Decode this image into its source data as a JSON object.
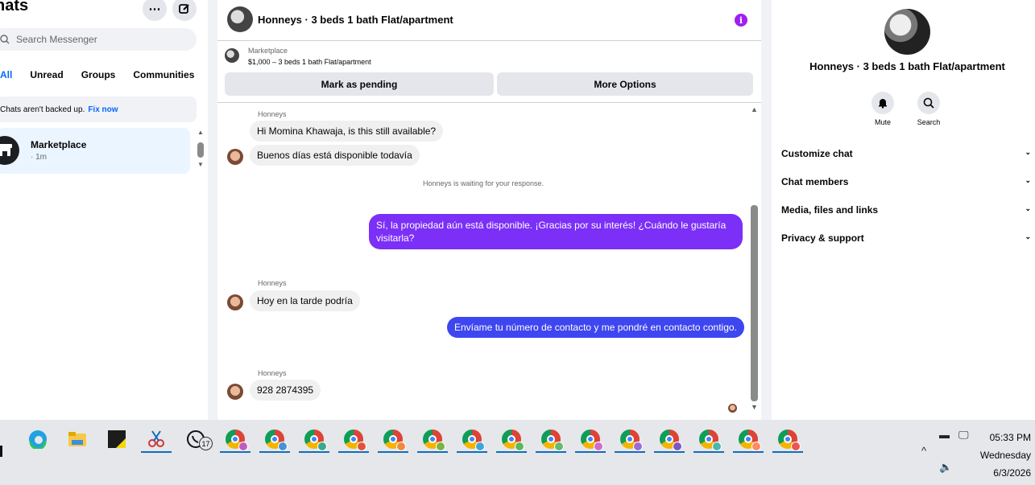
{
  "sidebar": {
    "title": "hats",
    "more_icon": "more-dots-icon",
    "compose_icon": "compose-icon",
    "search_placeholder": "Search Messenger",
    "filters": [
      "All",
      "Unread",
      "Groups",
      "Communities"
    ],
    "backup_note": "Chats aren't backed up.",
    "fix_link": "Fix now",
    "chats": [
      {
        "name": "Marketplace",
        "time": "· 1m"
      }
    ]
  },
  "conversation": {
    "title": "Honneys · 3 beds 1 bath Flat/apartment",
    "marketplace_label": "Marketplace",
    "listing": "$1,000 – 3 beds 1 bath Flat/apartment",
    "mark_pending": "Mark as pending",
    "more_options": "More Options",
    "messages": [
      {
        "sender": "Honneys",
        "text": "Hi Momina Khawaja, is this still available?"
      },
      {
        "text": "Buenos días está disponible todavía"
      },
      {
        "system": "Honneys is waiting for your response."
      },
      {
        "text": "Sí, la propiedad aún está disponible. ¡Gracias por su interés! ¿Cuándo le gustaría visitarla?"
      },
      {
        "sender": "Honneys",
        "text": "Hoy en la tarde podría"
      },
      {
        "text": "Envíame tu número de contacto y me pondré en contacto contigo."
      },
      {
        "sender": "Honneys",
        "text": "928 2874395"
      }
    ]
  },
  "details": {
    "title": "Honneys · 3 beds 1 bath Flat/apartment",
    "mute_label": "Mute",
    "search_label": "Search",
    "sections": [
      "Customize chat",
      "Chat members",
      "Media, files and links",
      "Privacy & support"
    ]
  },
  "taskbar": {
    "whatsapp_badge": "17",
    "time": "05:33 PM",
    "day": "Wednesday",
    "date": "6/3/2026"
  },
  "colors": {
    "accent": "#0866ff",
    "outgoing_purple": "#7b2ff7",
    "outgoing_blue": "#3e46f0"
  }
}
